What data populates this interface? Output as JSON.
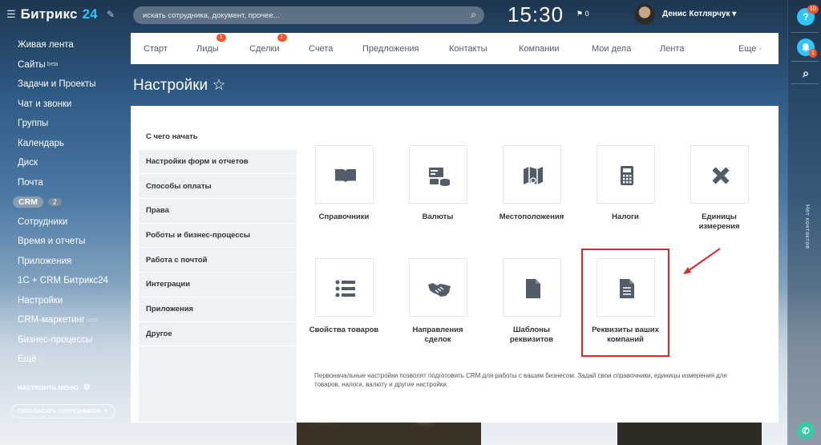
{
  "brand": {
    "name": "Битрикс",
    "num": "24"
  },
  "sidebar": {
    "items": [
      {
        "label": "Живая лента",
        "sup": ""
      },
      {
        "label": "Сайты",
        "sup": "beta"
      },
      {
        "label": "Задачи и Проекты",
        "sup": ""
      },
      {
        "label": "Чат и звонки",
        "sup": ""
      },
      {
        "label": "Группы",
        "sup": ""
      },
      {
        "label": "Календарь",
        "sup": ""
      },
      {
        "label": "Диск",
        "sup": ""
      },
      {
        "label": "Почта",
        "sup": ""
      },
      {
        "label": "CRM",
        "sup": "",
        "count": "2"
      },
      {
        "label": "Сотрудники",
        "sup": ""
      },
      {
        "label": "Время и отчеты",
        "sup": ""
      },
      {
        "label": "Приложения",
        "sup": ""
      },
      {
        "label": "1С + CRM Битрикс24",
        "sup": ""
      },
      {
        "label": "Настройки",
        "sup": ""
      },
      {
        "label": "CRM-маркетинг",
        "sup": "beta"
      },
      {
        "label": "Бизнес-процессы",
        "sup": ""
      },
      {
        "label": "Ещё ·",
        "sup": ""
      }
    ],
    "setup_menu": "НАСТРОИТЬ МЕНЮ",
    "invite": "ПРИГЛАСИТЬ СОТРУДНИКОВ"
  },
  "header": {
    "search_placeholder": "искать сотрудника, документ, прочее...",
    "time": "15:30",
    "flag_count": "0",
    "user_name": "Денис Котлярчук ▾"
  },
  "right_bar": {
    "help_badge": "10",
    "bell_badge": "1",
    "contacts_label": "Нет контактов"
  },
  "nav": [
    {
      "label": "Старт",
      "badge": ""
    },
    {
      "label": "Лиды",
      "badge": "1"
    },
    {
      "label": "Сделки",
      "badge": "1"
    },
    {
      "label": "Счета",
      "badge": ""
    },
    {
      "label": "Предложения",
      "badge": ""
    },
    {
      "label": "Контакты",
      "badge": ""
    },
    {
      "label": "Компании",
      "badge": ""
    },
    {
      "label": "Мои дела",
      "badge": ""
    },
    {
      "label": "Лента",
      "badge": ""
    },
    {
      "label": "Еще ·",
      "badge": ""
    }
  ],
  "page_title": "Настройки ☆",
  "settings_menu": [
    "С чего начать",
    "Настройки форм и отчетов",
    "Способы оплаты",
    "Права",
    "Роботы и бизнес-процессы",
    "Работа с почтой",
    "Интеграции",
    "Приложения",
    "Другое"
  ],
  "tiles": [
    {
      "label": "Справочники",
      "icon": "book-icon"
    },
    {
      "label": "Валюты",
      "icon": "currency-icon"
    },
    {
      "label": "Местоположения",
      "icon": "map-icon"
    },
    {
      "label": "Налоги",
      "icon": "tax-icon"
    },
    {
      "label": "Единицы\nизмерения",
      "icon": "ruler-icon"
    },
    {
      "label": "Свойства товаров",
      "icon": "list-icon"
    },
    {
      "label": "Направления\nсделок",
      "icon": "handshake-icon"
    },
    {
      "label": "Шаблоны\nреквизитов",
      "icon": "template-icon"
    },
    {
      "label": "Реквизиты ваших\nкомпаний",
      "icon": "document-icon"
    }
  ],
  "note": "Первоначальные настройки позволят подготовить CRM для работы с вашим бизнесом. Задай свои справочники, единицы измерения для товаров, налоги, валюту и другие настройки.",
  "colors": {
    "accent": "#2fc6f6",
    "badge": "#f2552c",
    "highlight": "#e0262b",
    "icon": "#535c69"
  }
}
